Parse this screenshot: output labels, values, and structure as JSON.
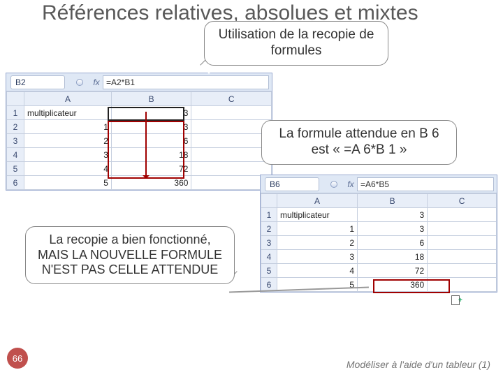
{
  "title": "Références relatives, absolues et mixtes",
  "callouts": {
    "top": "Utilisation de la recopie de formules",
    "mid": "La formule attendue en B 6 est « =A 6*B 1 »",
    "left": "La recopie a bien fonctionné, MAIS LA NOUVELLE FORMULE N'EST PAS CELLE ATTENDUE"
  },
  "page": "66",
  "footer": "Modéliser à l'aide d'un tableur (1)",
  "excel1": {
    "cellref": "B2",
    "formula": "=A2*B1",
    "fx": "fx",
    "cols": [
      "A",
      "B",
      "C"
    ],
    "rows": [
      {
        "n": "1",
        "a": "multiplicateur",
        "b": "3",
        "c": ""
      },
      {
        "n": "2",
        "a": "1",
        "b": "3",
        "c": ""
      },
      {
        "n": "3",
        "a": "2",
        "b": "6",
        "c": ""
      },
      {
        "n": "4",
        "a": "3",
        "b": "18",
        "c": ""
      },
      {
        "n": "5",
        "a": "4",
        "b": "72",
        "c": ""
      },
      {
        "n": "6",
        "a": "5",
        "b": "360",
        "c": ""
      }
    ]
  },
  "excel2": {
    "cellref": "B6",
    "formula": "=A6*B5",
    "fx": "fx",
    "cols": [
      "A",
      "B",
      "C"
    ],
    "rows": [
      {
        "n": "1",
        "a": "multiplicateur",
        "b": "3",
        "c": ""
      },
      {
        "n": "2",
        "a": "1",
        "b": "3",
        "c": ""
      },
      {
        "n": "3",
        "a": "2",
        "b": "6",
        "c": ""
      },
      {
        "n": "4",
        "a": "3",
        "b": "18",
        "c": ""
      },
      {
        "n": "5",
        "a": "4",
        "b": "72",
        "c": ""
      },
      {
        "n": "6",
        "a": "5",
        "b": "360",
        "c": ""
      }
    ]
  }
}
